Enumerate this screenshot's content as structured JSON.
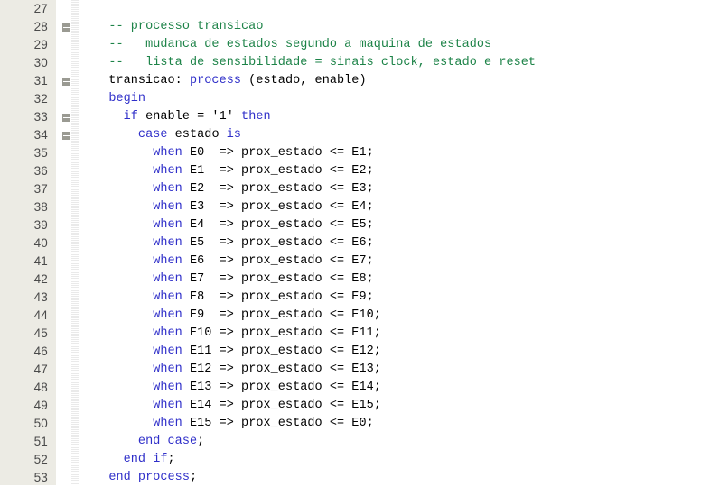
{
  "editor": {
    "language": "VHDL",
    "first_line_number": 27,
    "last_line_number": 53,
    "colors": {
      "background": "#ffffff",
      "gutter_background": "#ecebe4",
      "line_number": "#4a4a4a",
      "comment": "#1d8348",
      "keyword": "#2f2fc9",
      "identifier": "#000000",
      "fold_marker": "#9a9a92"
    }
  },
  "lines": [
    {
      "number": "27",
      "fold": false,
      "tokens": []
    },
    {
      "number": "28",
      "fold": true,
      "tokens": [
        {
          "t": "plain",
          "s": "  "
        },
        {
          "t": "comment",
          "s": "-- processo transicao"
        }
      ]
    },
    {
      "number": "29",
      "fold": false,
      "tokens": [
        {
          "t": "plain",
          "s": "  "
        },
        {
          "t": "comment",
          "s": "--   mudanca de estados segundo a maquina de estados"
        }
      ]
    },
    {
      "number": "30",
      "fold": false,
      "tokens": [
        {
          "t": "plain",
          "s": "  "
        },
        {
          "t": "comment",
          "s": "--   lista de sensibilidade = sinais clock, estado e reset"
        }
      ]
    },
    {
      "number": "31",
      "fold": true,
      "tokens": [
        {
          "t": "plain",
          "s": "  transicao: "
        },
        {
          "t": "keyword",
          "s": "process"
        },
        {
          "t": "plain",
          "s": " (estado, enable)"
        }
      ]
    },
    {
      "number": "32",
      "fold": false,
      "tokens": [
        {
          "t": "plain",
          "s": "  "
        },
        {
          "t": "keyword",
          "s": "begin"
        }
      ]
    },
    {
      "number": "33",
      "fold": true,
      "tokens": [
        {
          "t": "plain",
          "s": "    "
        },
        {
          "t": "keyword",
          "s": "if"
        },
        {
          "t": "plain",
          "s": " enable = '1' "
        },
        {
          "t": "keyword",
          "s": "then"
        }
      ]
    },
    {
      "number": "34",
      "fold": true,
      "tokens": [
        {
          "t": "plain",
          "s": "      "
        },
        {
          "t": "keyword",
          "s": "case"
        },
        {
          "t": "plain",
          "s": " estado "
        },
        {
          "t": "keyword",
          "s": "is"
        }
      ]
    },
    {
      "number": "35",
      "fold": false,
      "tokens": [
        {
          "t": "plain",
          "s": "        "
        },
        {
          "t": "keyword",
          "s": "when"
        },
        {
          "t": "plain",
          "s": " E0  => prox_estado <= E1;"
        }
      ]
    },
    {
      "number": "36",
      "fold": false,
      "tokens": [
        {
          "t": "plain",
          "s": "        "
        },
        {
          "t": "keyword",
          "s": "when"
        },
        {
          "t": "plain",
          "s": " E1  => prox_estado <= E2;"
        }
      ]
    },
    {
      "number": "37",
      "fold": false,
      "tokens": [
        {
          "t": "plain",
          "s": "        "
        },
        {
          "t": "keyword",
          "s": "when"
        },
        {
          "t": "plain",
          "s": " E2  => prox_estado <= E3;"
        }
      ]
    },
    {
      "number": "38",
      "fold": false,
      "tokens": [
        {
          "t": "plain",
          "s": "        "
        },
        {
          "t": "keyword",
          "s": "when"
        },
        {
          "t": "plain",
          "s": " E3  => prox_estado <= E4;"
        }
      ]
    },
    {
      "number": "39",
      "fold": false,
      "tokens": [
        {
          "t": "plain",
          "s": "        "
        },
        {
          "t": "keyword",
          "s": "when"
        },
        {
          "t": "plain",
          "s": " E4  => prox_estado <= E5;"
        }
      ]
    },
    {
      "number": "40",
      "fold": false,
      "tokens": [
        {
          "t": "plain",
          "s": "        "
        },
        {
          "t": "keyword",
          "s": "when"
        },
        {
          "t": "plain",
          "s": " E5  => prox_estado <= E6;"
        }
      ]
    },
    {
      "number": "41",
      "fold": false,
      "tokens": [
        {
          "t": "plain",
          "s": "        "
        },
        {
          "t": "keyword",
          "s": "when"
        },
        {
          "t": "plain",
          "s": " E6  => prox_estado <= E7;"
        }
      ]
    },
    {
      "number": "42",
      "fold": false,
      "tokens": [
        {
          "t": "plain",
          "s": "        "
        },
        {
          "t": "keyword",
          "s": "when"
        },
        {
          "t": "plain",
          "s": " E7  => prox_estado <= E8;"
        }
      ]
    },
    {
      "number": "43",
      "fold": false,
      "tokens": [
        {
          "t": "plain",
          "s": "        "
        },
        {
          "t": "keyword",
          "s": "when"
        },
        {
          "t": "plain",
          "s": " E8  => prox_estado <= E9;"
        }
      ]
    },
    {
      "number": "44",
      "fold": false,
      "tokens": [
        {
          "t": "plain",
          "s": "        "
        },
        {
          "t": "keyword",
          "s": "when"
        },
        {
          "t": "plain",
          "s": " E9  => prox_estado <= E10;"
        }
      ]
    },
    {
      "number": "45",
      "fold": false,
      "tokens": [
        {
          "t": "plain",
          "s": "        "
        },
        {
          "t": "keyword",
          "s": "when"
        },
        {
          "t": "plain",
          "s": " E10 => prox_estado <= E11;"
        }
      ]
    },
    {
      "number": "46",
      "fold": false,
      "tokens": [
        {
          "t": "plain",
          "s": "        "
        },
        {
          "t": "keyword",
          "s": "when"
        },
        {
          "t": "plain",
          "s": " E11 => prox_estado <= E12;"
        }
      ]
    },
    {
      "number": "47",
      "fold": false,
      "tokens": [
        {
          "t": "plain",
          "s": "        "
        },
        {
          "t": "keyword",
          "s": "when"
        },
        {
          "t": "plain",
          "s": " E12 => prox_estado <= E13;"
        }
      ]
    },
    {
      "number": "48",
      "fold": false,
      "tokens": [
        {
          "t": "plain",
          "s": "        "
        },
        {
          "t": "keyword",
          "s": "when"
        },
        {
          "t": "plain",
          "s": " E13 => prox_estado <= E14;"
        }
      ]
    },
    {
      "number": "49",
      "fold": false,
      "tokens": [
        {
          "t": "plain",
          "s": "        "
        },
        {
          "t": "keyword",
          "s": "when"
        },
        {
          "t": "plain",
          "s": " E14 => prox_estado <= E15;"
        }
      ]
    },
    {
      "number": "50",
      "fold": false,
      "tokens": [
        {
          "t": "plain",
          "s": "        "
        },
        {
          "t": "keyword",
          "s": "when"
        },
        {
          "t": "plain",
          "s": " E15 => prox_estado <= E0;"
        }
      ]
    },
    {
      "number": "51",
      "fold": false,
      "tokens": [
        {
          "t": "plain",
          "s": "      "
        },
        {
          "t": "keyword",
          "s": "end case"
        },
        {
          "t": "plain",
          "s": ";"
        }
      ]
    },
    {
      "number": "52",
      "fold": false,
      "tokens": [
        {
          "t": "plain",
          "s": "    "
        },
        {
          "t": "keyword",
          "s": "end if"
        },
        {
          "t": "plain",
          "s": ";"
        }
      ]
    },
    {
      "number": "53",
      "fold": false,
      "tokens": [
        {
          "t": "plain",
          "s": "  "
        },
        {
          "t": "keyword",
          "s": "end process"
        },
        {
          "t": "plain",
          "s": ";"
        }
      ]
    }
  ]
}
